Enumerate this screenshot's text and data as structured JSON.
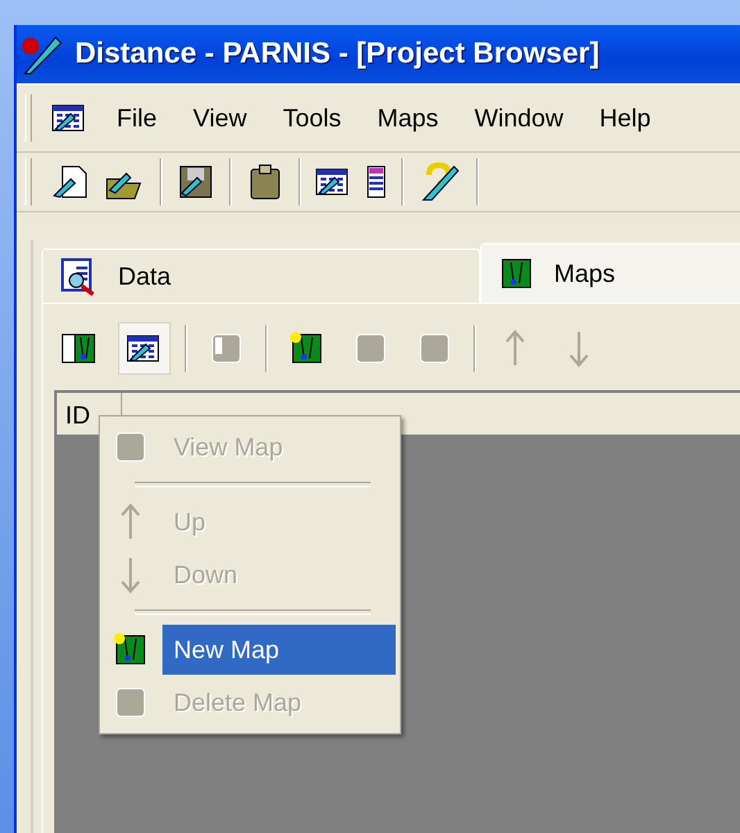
{
  "window": {
    "title": "Distance - PARNIS - [Project Browser]"
  },
  "menu_bar": [
    {
      "label": "File"
    },
    {
      "label": "View"
    },
    {
      "label": "Tools"
    },
    {
      "label": "Maps"
    },
    {
      "label": "Window"
    },
    {
      "label": "Help"
    }
  ],
  "tabs": [
    {
      "label": "Data",
      "selected": false
    },
    {
      "label": "Maps",
      "selected": true
    }
  ],
  "maps_toolbar": [
    {
      "disabled": false,
      "selected": false
    },
    {
      "disabled": false,
      "selected": true
    },
    {
      "disabled": true,
      "selected": false
    },
    {
      "disabled": false,
      "selected": false
    },
    {
      "disabled": true,
      "selected": false
    },
    {
      "disabled": true,
      "selected": false
    },
    {
      "disabled": true,
      "selected": false
    },
    {
      "disabled": true,
      "selected": false
    }
  ],
  "table": {
    "columns": [
      "ID"
    ]
  },
  "context_menu": [
    {
      "kind": "item",
      "label": "View Map",
      "disabled": true,
      "selected": false
    },
    {
      "kind": "separator"
    },
    {
      "kind": "item",
      "label": "Up",
      "disabled": true,
      "selected": false
    },
    {
      "kind": "item",
      "label": "Down",
      "disabled": true,
      "selected": false
    },
    {
      "kind": "separator"
    },
    {
      "kind": "item",
      "label": "New Map",
      "disabled": false,
      "selected": true
    },
    {
      "kind": "item",
      "label": "Delete Map",
      "disabled": true,
      "selected": false
    }
  ]
}
